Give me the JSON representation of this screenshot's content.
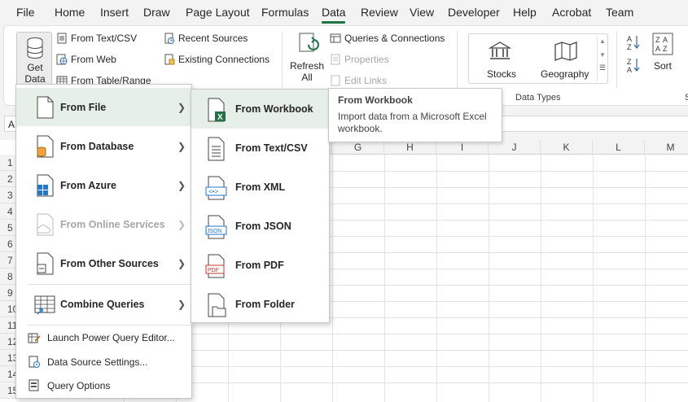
{
  "menubar": {
    "tabs": [
      {
        "label": "File"
      },
      {
        "label": "Home"
      },
      {
        "label": "Insert"
      },
      {
        "label": "Draw"
      },
      {
        "label": "Page Layout"
      },
      {
        "label": "Formulas"
      },
      {
        "label": "Data"
      },
      {
        "label": "Review"
      },
      {
        "label": "View"
      },
      {
        "label": "Developer"
      },
      {
        "label": "Help"
      },
      {
        "label": "Acrobat"
      },
      {
        "label": "Team"
      }
    ],
    "active": "Data"
  },
  "ribbon": {
    "get_data_line1": "Get",
    "get_data_line2": "Data",
    "from_text_csv": "From Text/CSV",
    "from_web": "From Web",
    "from_table_range": "From Table/Range",
    "recent_sources": "Recent Sources",
    "existing_connections": "Existing Connections",
    "refresh_line1": "Refresh",
    "refresh_line2": "All",
    "queries_connections": "Queries & Connections",
    "properties": "Properties",
    "edit_links": "Edit Links",
    "stocks": "Stocks",
    "geography": "Geography",
    "data_types_label": "Data Types",
    "sort": "Sort",
    "cut_off": "S"
  },
  "namebox": "A",
  "grid": {
    "columns": [
      "G",
      "H",
      "I",
      "J",
      "K",
      "L",
      "M"
    ],
    "rows": [
      "1",
      "2",
      "3",
      "4",
      "5",
      "6",
      "7",
      "8",
      "9",
      "10",
      "11",
      "12",
      "13",
      "14",
      "15"
    ]
  },
  "menu_get_data": {
    "items": [
      {
        "label": "From File",
        "hotkey": "F"
      },
      {
        "label": "From Database",
        "hotkey": "D"
      },
      {
        "label": "From Azure",
        "hotkey": "A"
      },
      {
        "label": "From Online Services",
        "hotkey": "O"
      },
      {
        "label": "From Other Sources",
        "hotkey": "O"
      },
      {
        "label": "Combine Queries",
        "hotkey": "Q"
      }
    ],
    "small_items": [
      {
        "label": "Launch Power Query Editor..."
      },
      {
        "label": "Data Source Settings..."
      },
      {
        "label": "Query Options"
      }
    ]
  },
  "menu_from_file": {
    "items": [
      {
        "label": "From Workbook"
      },
      {
        "label": "From Text/CSV"
      },
      {
        "label": "From XML"
      },
      {
        "label": "From JSON"
      },
      {
        "label": "From PDF"
      },
      {
        "label": "From Folder"
      }
    ]
  },
  "tooltip": {
    "title": "From Workbook",
    "description": "Import data from a Microsoft Excel workbook."
  },
  "colors": {
    "accent": "#217346",
    "hover": "#e7efe9"
  }
}
